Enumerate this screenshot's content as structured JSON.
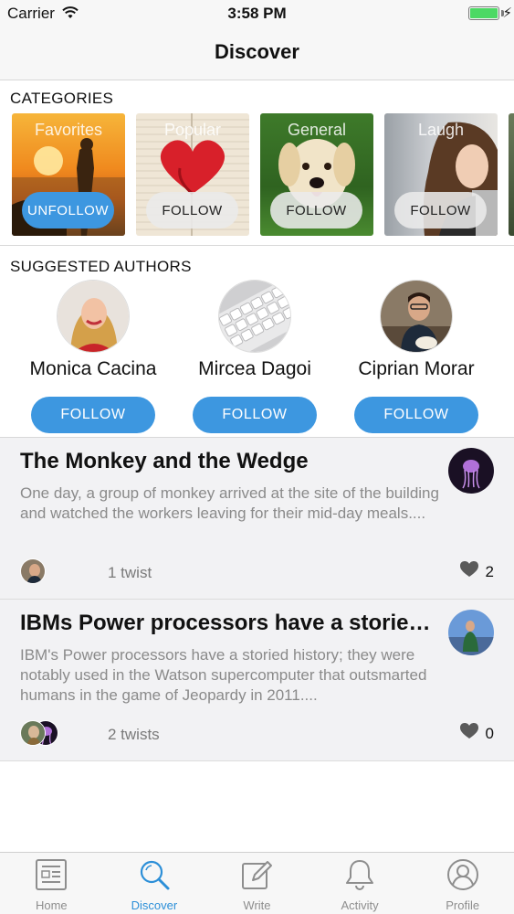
{
  "status_bar": {
    "carrier": "Carrier",
    "time": "3:58 PM"
  },
  "nav": {
    "title": "Discover"
  },
  "categories": {
    "heading": "CATEGORIES",
    "items": [
      {
        "label": "Favorites",
        "button": "UNFOLLOW",
        "following": true
      },
      {
        "label": "Popular",
        "button": "FOLLOW",
        "following": false
      },
      {
        "label": "General",
        "button": "FOLLOW",
        "following": false
      },
      {
        "label": "Laugh",
        "button": "FOLLOW",
        "following": false
      }
    ]
  },
  "authors": {
    "heading": "SUGGESTED AUTHORS",
    "items": [
      {
        "name": "Monica Cacina",
        "button": "FOLLOW"
      },
      {
        "name": "Mircea Dagoi",
        "button": "FOLLOW"
      },
      {
        "name": "Ciprian Morar",
        "button": "FOLLOW"
      }
    ]
  },
  "feed": {
    "posts": [
      {
        "title": "The Monkey and the Wedge",
        "body": "One day, a group of monkey arrived at the site of the building and watched the workers leaving for their mid-day meals....",
        "twists": "1 twist",
        "likes": "2"
      },
      {
        "title": "IBMs Power processors have a storied...",
        "body": "IBM's Power processors have a storied history; they were notably used in the Watson supercomputer that outsmarted humans in the game of Jeopardy in 2011....",
        "twists": "2 twists",
        "likes": "0"
      }
    ]
  },
  "tabs": [
    {
      "label": "Home",
      "icon": "home-icon",
      "active": false
    },
    {
      "label": "Discover",
      "icon": "search-icon",
      "active": true
    },
    {
      "label": "Write",
      "icon": "pencil-icon",
      "active": false
    },
    {
      "label": "Activity",
      "icon": "bell-icon",
      "active": false
    },
    {
      "label": "Profile",
      "icon": "profile-icon",
      "active": false
    }
  ],
  "colors": {
    "accent": "#3d97e0",
    "active_tab": "#2c8fd8",
    "feed_bg": "#f2f2f4"
  }
}
